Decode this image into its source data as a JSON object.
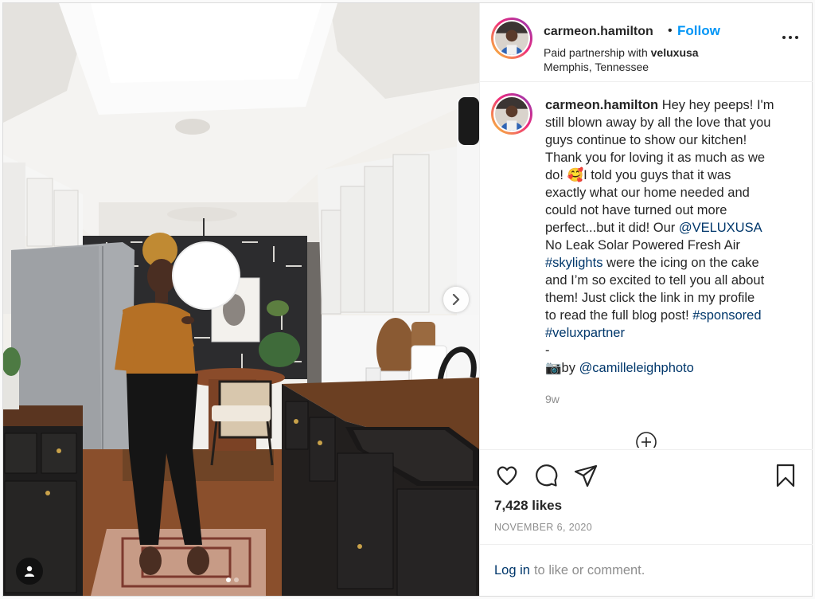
{
  "post": {
    "username": "carmeon.hamilton",
    "separator": "•",
    "follow_label": "Follow",
    "partnership_prefix": "Paid partnership with",
    "partner": "veluxusa",
    "location": "Memphis, Tennessee",
    "more_icon": "more-options-icon"
  },
  "caption": {
    "username": "carmeon.hamilton",
    "line1": "Hey hey peeps! I'm",
    "line2": "still blown away by all the love that you",
    "line3": "guys continue to show our kitchen!",
    "line4": "Thank you for loving it as much as we",
    "line5a": "do! ",
    "emoji": "🥰",
    "line5b": "I told you guys that it was",
    "line6": "exactly what our home needed and",
    "line7": "could not have turned out more",
    "line8a": "perfect...but it did! Our ",
    "mention1": "@VELUXUSA",
    "line9": "No Leak Solar Powered Fresh Air",
    "hashtag1": "#skylights",
    "line10b": " were the icing on the cake",
    "line11": "and I’m so excited to tell you all about",
    "line12": "them! Just click the link in my profile",
    "line13a": "to read the full blog post! ",
    "hashtag2": "#sponsored",
    "hashtag3": "#veluxpartner",
    "dash": "-",
    "camera_emoji": "📷",
    "photo_by": "by ",
    "mention2": "@camilleleighphoto",
    "time_ago": "9w"
  },
  "actions": {
    "like_icon": "heart-icon",
    "comment_icon": "comment-icon",
    "share_icon": "paper-plane-icon",
    "save_icon": "bookmark-icon",
    "likes": "7,428 likes",
    "date": "NOVEMBER 6, 2020",
    "login_link": "Log in",
    "login_suffix": "to like or comment."
  },
  "media": {
    "carousel_dots": 2,
    "active_dot": 0,
    "next_icon": "chevron-right-icon",
    "tag_icon": "user-tag-icon"
  },
  "colors": {
    "link_blue": "#0095f6",
    "link_dark": "#00376b",
    "text": "#262626",
    "muted": "#8e8e8e"
  }
}
